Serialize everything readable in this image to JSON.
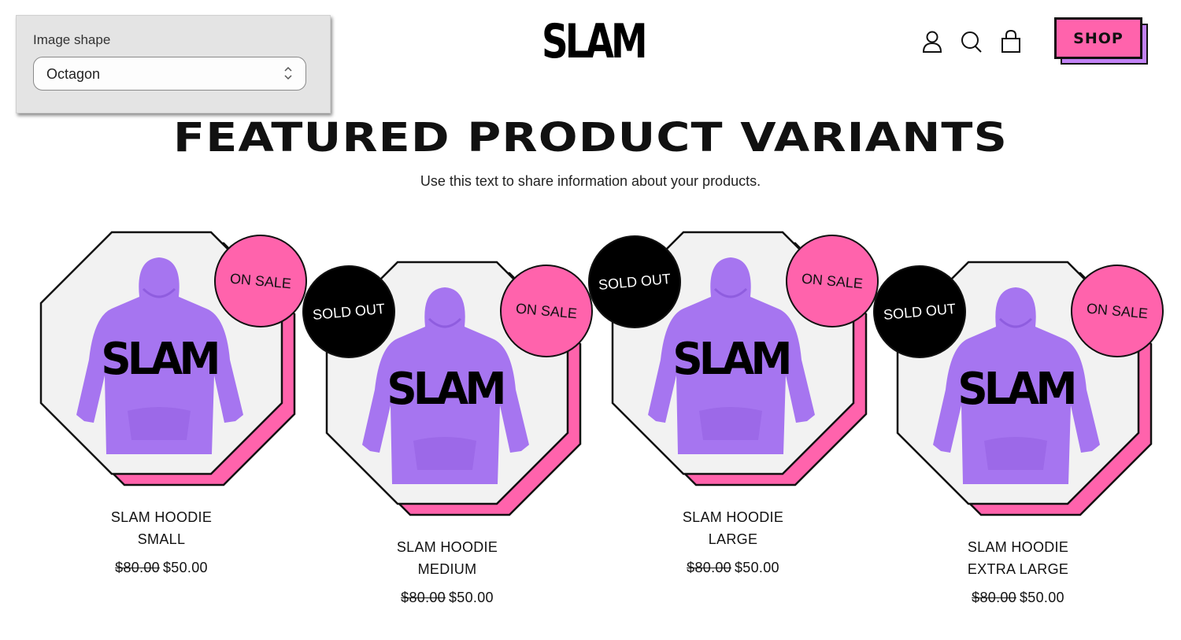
{
  "settings_panel": {
    "label": "Image shape",
    "select_value": "Octagon"
  },
  "header": {
    "logo": "SLAM",
    "icons": [
      "account-icon",
      "search-icon",
      "cart-icon"
    ],
    "shop_label": "SHOP"
  },
  "section": {
    "title": "FEATURED PRODUCT VARIANTS",
    "subtitle": "Use this text to share information about your products."
  },
  "colors": {
    "pink": "#ff63ac",
    "purple": "#c283f5",
    "hoodie": "#a675f0",
    "image_bg": "#f2f2f2"
  },
  "products": [
    {
      "title": "SLAM HOODIE",
      "variant": "SMALL",
      "compare_price": "$80.00",
      "price": "$50.00",
      "badges": [
        "ON SALE"
      ],
      "print": "SLAM"
    },
    {
      "title": "SLAM HOODIE",
      "variant": "MEDIUM",
      "compare_price": "$80.00",
      "price": "$50.00",
      "badges": [
        "SOLD OUT",
        "ON SALE"
      ],
      "print": "SLAM"
    },
    {
      "title": "SLAM HOODIE",
      "variant": "LARGE",
      "compare_price": "$80.00",
      "price": "$50.00",
      "badges": [
        "SOLD OUT",
        "ON SALE"
      ],
      "print": "SLAM"
    },
    {
      "title": "SLAM HOODIE",
      "variant": "EXTRA LARGE",
      "compare_price": "$80.00",
      "price": "$50.00",
      "badges": [
        "SOLD OUT",
        "ON SALE"
      ],
      "print": "SLAM"
    }
  ]
}
